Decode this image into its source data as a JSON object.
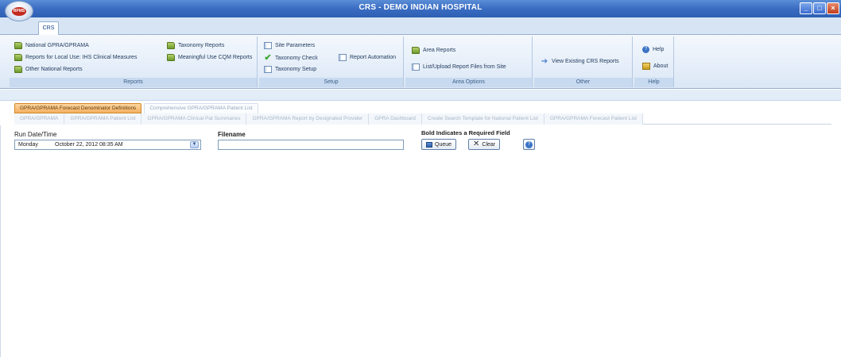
{
  "window": {
    "title": "CRS - DEMO INDIAN HOSPITAL",
    "logo_text": "RPMS",
    "controls": [
      "_",
      "□",
      "×"
    ]
  },
  "ribbon_tab": "CRS",
  "ribbon": {
    "reports": {
      "label": "Reports",
      "items": [
        "National GPRA/GPRAMA",
        "Reports for Local Use: IHS Clinical Measures",
        "Other National Reports",
        "Taxonomy Reports",
        "Meaningful Use CQM Reports"
      ]
    },
    "setup": {
      "label": "Setup",
      "items": [
        "Site Parameters",
        "Taxonomy Check",
        "Taxonomy Setup",
        "Report Automation"
      ]
    },
    "area": {
      "label": "Area Options",
      "items": [
        "Area Reports",
        "List/Upload Report Files from Site"
      ]
    },
    "other": {
      "label": "Other",
      "items": [
        "View Existing CRS Reports"
      ]
    },
    "help": {
      "label": "Help",
      "items": [
        "Help",
        "About"
      ]
    }
  },
  "tabs_row1": [
    "GPRA/GPRAMA Forecast Denominator Definitions",
    "Comprehensive GPRA/GPRAMA Patient List"
  ],
  "tabs_row2": [
    "GPRA/GPRAMA",
    "GPRA/GPRAMA Patient List",
    "GPRA/GPRAMA Clinical Pat Summaries",
    "GPRA/GPRAMA Report by Designated Provider",
    "GPRA Dashboard",
    "Create Search Template for National Patient List",
    "GPRA/GPRAMA Forecast Patient List"
  ],
  "form": {
    "run_label": "Run Date/Time",
    "run_day": "Monday",
    "run_date": "October  22, 2012  08:35 AM",
    "filename_label": "Filename",
    "filename_value": "",
    "required_note": "Bold Indicates a Required Field",
    "queue_label": "Queue",
    "clear_label": "Clear"
  },
  "colors": {
    "titlebar": "#3a6cc2",
    "active_tab": "#f4b062",
    "ribbon_bg": "#dbe7f6"
  }
}
